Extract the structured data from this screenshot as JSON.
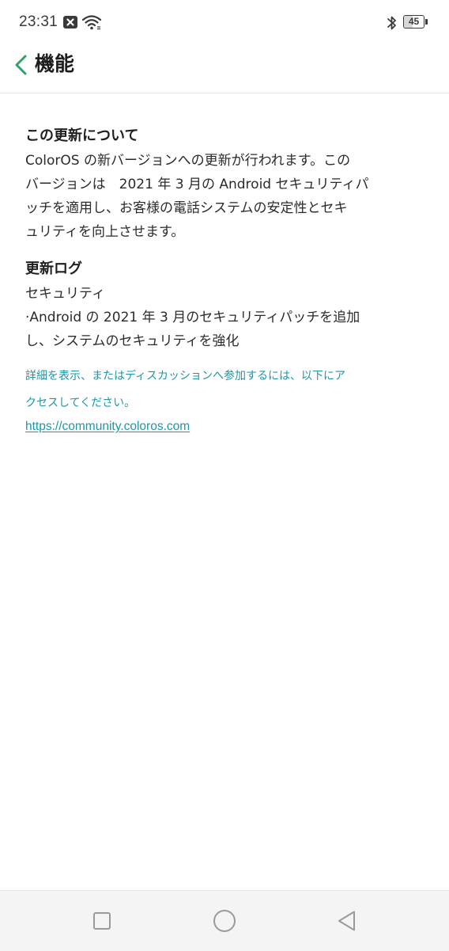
{
  "status_bar": {
    "time": "23:31",
    "battery_level": "45",
    "battery_fraction": 0.45,
    "icons": [
      "notification-x-icon",
      "wifi-icon",
      "bluetooth-icon",
      "battery-icon"
    ]
  },
  "header": {
    "title": "機能",
    "back_icon": "chevron-left-icon",
    "accent_color": "#2fa36b"
  },
  "main": {
    "sections": [
      {
        "heading": "この更新について",
        "body": "ColorOS の新バージョンへの更新が行われます。この\nバージョンは　2021 年 3 月の Android セキュリティパ\nッチを適用し、お客様の電話システムの安定性とセキ\nュリティを向上させます。"
      },
      {
        "heading": "更新ログ",
        "body": "セキュリティ\n·Android の 2021 年 3 月のセキュリティパッチを追加\nし、システムのセキュリティを強化"
      }
    ],
    "note": "詳細を表示、またはディスカッションへ参加するには、以下にア\nクセスしてください。",
    "link": "https://community.coloros.com",
    "link_color": "#1d97a7"
  },
  "nav_bar": {
    "buttons": [
      "recent-apps-icon",
      "home-icon",
      "back-triangle-icon"
    ]
  }
}
